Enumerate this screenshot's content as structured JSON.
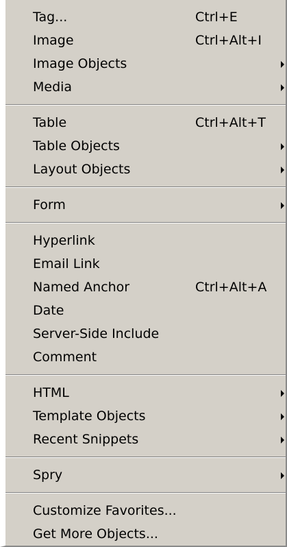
{
  "menu": {
    "groups": [
      {
        "items": [
          {
            "label": "Tag...",
            "shortcut": "Ctrl+E"
          },
          {
            "label": "Image",
            "shortcut": "Ctrl+Alt+I"
          },
          {
            "label": "Image Objects"
          },
          {
            "label": "Media"
          }
        ]
      },
      {
        "items": [
          {
            "label": "Table",
            "shortcut": "Ctrl+Alt+T"
          },
          {
            "label": "Table Objects"
          },
          {
            "label": "Layout Objects"
          }
        ]
      },
      {
        "items": [
          {
            "label": "Form"
          }
        ]
      },
      {
        "items": [
          {
            "label": "Hyperlink"
          },
          {
            "label": "Email Link"
          },
          {
            "label": "Named Anchor",
            "shortcut": "Ctrl+Alt+A"
          },
          {
            "label": "Date"
          },
          {
            "label": "Server-Side Include"
          },
          {
            "label": "Comment"
          }
        ]
      },
      {
        "items": [
          {
            "label": "HTML"
          },
          {
            "label": "Template Objects"
          },
          {
            "label": "Recent Snippets"
          }
        ]
      },
      {
        "items": [
          {
            "label": "Spry"
          }
        ]
      },
      {
        "items": [
          {
            "label": "Customize Favorites..."
          },
          {
            "label": "Get More Objects..."
          }
        ]
      }
    ]
  }
}
